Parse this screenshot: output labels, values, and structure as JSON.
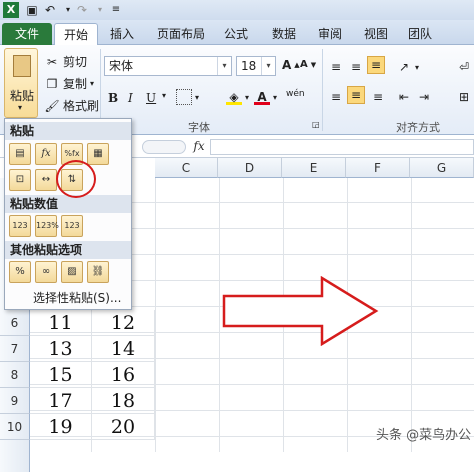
{
  "quick_access": {
    "save_icon": "save-icon",
    "undo_icon": "undo-icon",
    "redo_icon": "redo-icon"
  },
  "tabs": [
    "文件",
    "开始",
    "插入",
    "页面布局",
    "公式",
    "数据",
    "审阅",
    "视图",
    "团队"
  ],
  "clipboard": {
    "paste": "粘贴",
    "cut": "剪切",
    "copy": "复制",
    "format_painter": "格式刷"
  },
  "font": {
    "name": "宋体",
    "size": "18",
    "bold": "B",
    "italic": "I",
    "underline": "U",
    "group_label": "字体"
  },
  "alignment": {
    "group_label": "对齐方式"
  },
  "columns": [
    "C",
    "D",
    "E",
    "F",
    "G"
  ],
  "rows": [
    {
      "num": "6",
      "a": "11",
      "b": "12"
    },
    {
      "num": "7",
      "a": "13",
      "b": "14"
    },
    {
      "num": "8",
      "a": "15",
      "b": "16"
    },
    {
      "num": "9",
      "a": "17",
      "b": "18"
    },
    {
      "num": "10",
      "a": "19",
      "b": "20"
    }
  ],
  "paste_menu": {
    "section_paste": "粘贴",
    "section_values": "粘贴数值",
    "section_other": "其他粘贴选项",
    "paste_special": "选择性粘贴(S)..."
  },
  "formula_bar": {
    "fx": "fx"
  },
  "watermark": "头条 @菜鸟办公",
  "colors": {
    "file_tab": "#2a7a3b",
    "highlight": "#d61c1c"
  }
}
